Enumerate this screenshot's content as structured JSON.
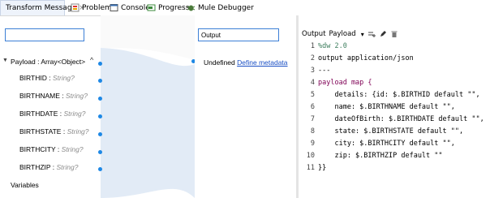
{
  "tabs": [
    {
      "label": "Transform Message",
      "icon": "transform-icon",
      "active": true
    },
    {
      "label": "Problems",
      "icon": "problems-icon"
    },
    {
      "label": "Console",
      "icon": "console-icon"
    },
    {
      "label": "Progress",
      "icon": "progress-icon"
    },
    {
      "label": "Mule Debugger",
      "icon": "debugger-icon"
    }
  ],
  "tab_close": "×",
  "input_panel": {
    "search_value": "",
    "root_label": "Payload : Array<Object>",
    "fields": [
      {
        "name": "BIRTHID",
        "type": "String?"
      },
      {
        "name": "BIRTHNAME",
        "type": "String?"
      },
      {
        "name": "BIRTHDATE",
        "type": "String?"
      },
      {
        "name": "BIRTHSTATE",
        "type": "String?"
      },
      {
        "name": "BIRTHCITY",
        "type": "String?"
      },
      {
        "name": "BIRTHZIP",
        "type": "String?"
      }
    ],
    "variables_label": "Variables"
  },
  "output_panel": {
    "field_value": "Output",
    "undefined_label": "Undefined",
    "define_link": "Define metadata"
  },
  "editor": {
    "toolbar": {
      "output_label": "Output",
      "payload_label": "Payload",
      "dropdown": "▾"
    },
    "lines": [
      {
        "n": "1",
        "text": "%dw 2.0"
      },
      {
        "n": "2",
        "text": "output application/json"
      },
      {
        "n": "3",
        "text": "---"
      },
      {
        "n": "4",
        "text": "payload map {"
      },
      {
        "n": "5",
        "text": "    details: {id: $.BIRTHID default \"\","
      },
      {
        "n": "6",
        "text": "    name: $.BIRTHNAME default \"\","
      },
      {
        "n": "7",
        "text": "    dateOfBirth: $.BIRTHDATE default \"\","
      },
      {
        "n": "8",
        "text": "    state: $.BIRTHSTATE default \"\","
      },
      {
        "n": "9",
        "text": "    city: $.BIRTHCITY default \"\","
      },
      {
        "n": "10",
        "text": "    zip: $.BIRTHZIP default \"\""
      },
      {
        "n": "11",
        "text": "}}"
      }
    ]
  },
  "colors": {
    "accent": "#1e88e5",
    "link": "#1a4fc4",
    "keyword": "#7f0055",
    "string": "#2a00ff"
  }
}
